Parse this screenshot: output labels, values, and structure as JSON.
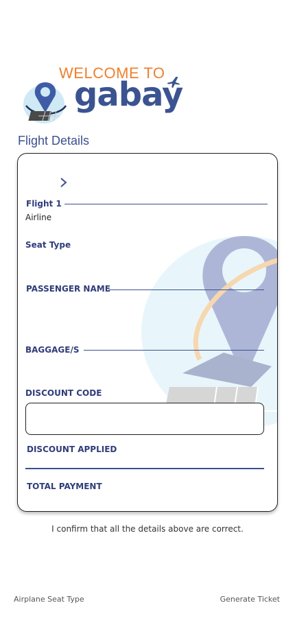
{
  "header": {
    "welcome_text": "WELCOME TO",
    "brand_name": "gabay",
    "logo_icon": "map-pin-plane-icon"
  },
  "page": {
    "title": "Flight Details"
  },
  "form": {
    "chevron_icon": "chevron-right-icon",
    "flight_label": "Flight 1",
    "airline_label": "Airline",
    "seat_type_label": "Seat Type",
    "passenger_name_label": "PASSENGER NAME",
    "baggage_label": "BAGGAGE/S",
    "discount_code_label": "DISCOUNT CODE",
    "discount_code_value": "",
    "discount_applied_label": "DISCOUNT APPLIED",
    "total_payment_label": "TOTAL PAYMENT"
  },
  "confirmation": {
    "text": "I confirm that all the details above are correct."
  },
  "footer": {
    "left_link": "Airplane Seat Type",
    "right_link": "Generate Ticket"
  },
  "colors": {
    "brand_orange": "#ef7f2c",
    "brand_blue": "#3b5391",
    "label_blue": "#2f3d7a"
  }
}
